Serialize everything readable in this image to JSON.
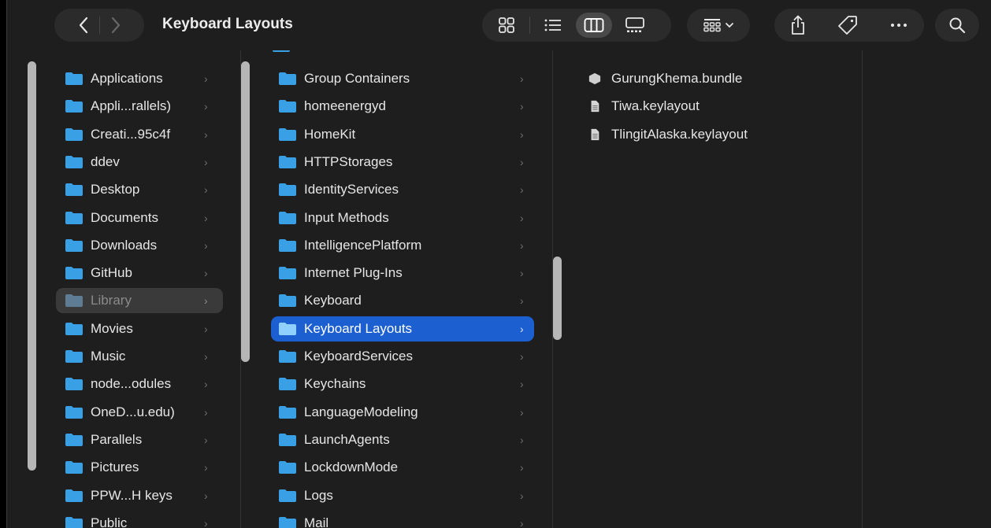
{
  "window": {
    "title": "Keyboard Layouts"
  },
  "colors": {
    "accent": "#1b5fd1",
    "folder": "#3aa0e6",
    "background": "#1e1e1e"
  },
  "toolbar": {
    "icons": [
      "chevron-left-icon",
      "chevron-right-icon",
      "icon-view-icon",
      "list-view-icon",
      "column-view-icon",
      "gallery-view-icon",
      "group-icon",
      "share-icon",
      "tag-icon",
      "more-icon",
      "search-icon"
    ],
    "active_view": "column"
  },
  "sidebar": {
    "items": [
      {
        "label": "Applications"
      },
      {
        "label": "Appli...rallels)"
      },
      {
        "label": "Creati...95c4f"
      },
      {
        "label": "ddev"
      },
      {
        "label": "Desktop"
      },
      {
        "label": "Documents"
      },
      {
        "label": "Downloads"
      },
      {
        "label": "GitHub"
      },
      {
        "label": "Library",
        "state": "selected-inactive"
      },
      {
        "label": "Movies"
      },
      {
        "label": "Music"
      },
      {
        "label": "node...odules"
      },
      {
        "label": "OneD...u.edu)"
      },
      {
        "label": "Parallels"
      },
      {
        "label": "Pictures"
      },
      {
        "label": "PPW...H keys"
      },
      {
        "label": "Public"
      }
    ]
  },
  "library_column": {
    "items": [
      {
        "label": "Group Containers"
      },
      {
        "label": "homeenergyd"
      },
      {
        "label": "HomeKit"
      },
      {
        "label": "HTTPStorages"
      },
      {
        "label": "IdentityServices"
      },
      {
        "label": "Input Methods"
      },
      {
        "label": "IntelligencePlatform"
      },
      {
        "label": "Internet Plug-Ins"
      },
      {
        "label": "Keyboard"
      },
      {
        "label": "Keyboard Layouts",
        "state": "selected"
      },
      {
        "label": "KeyboardServices"
      },
      {
        "label": "Keychains"
      },
      {
        "label": "LanguageModeling"
      },
      {
        "label": "LaunchAgents"
      },
      {
        "label": "LockdownMode"
      },
      {
        "label": "Logs"
      },
      {
        "label": "Mail"
      }
    ]
  },
  "layouts_column": {
    "items": [
      {
        "label": "GurungKhema.bundle",
        "icon": "bundle-icon"
      },
      {
        "label": "Tiwa.keylayout",
        "icon": "document-icon"
      },
      {
        "label": "TlingitAlaska.keylayout",
        "icon": "document-icon"
      }
    ]
  }
}
